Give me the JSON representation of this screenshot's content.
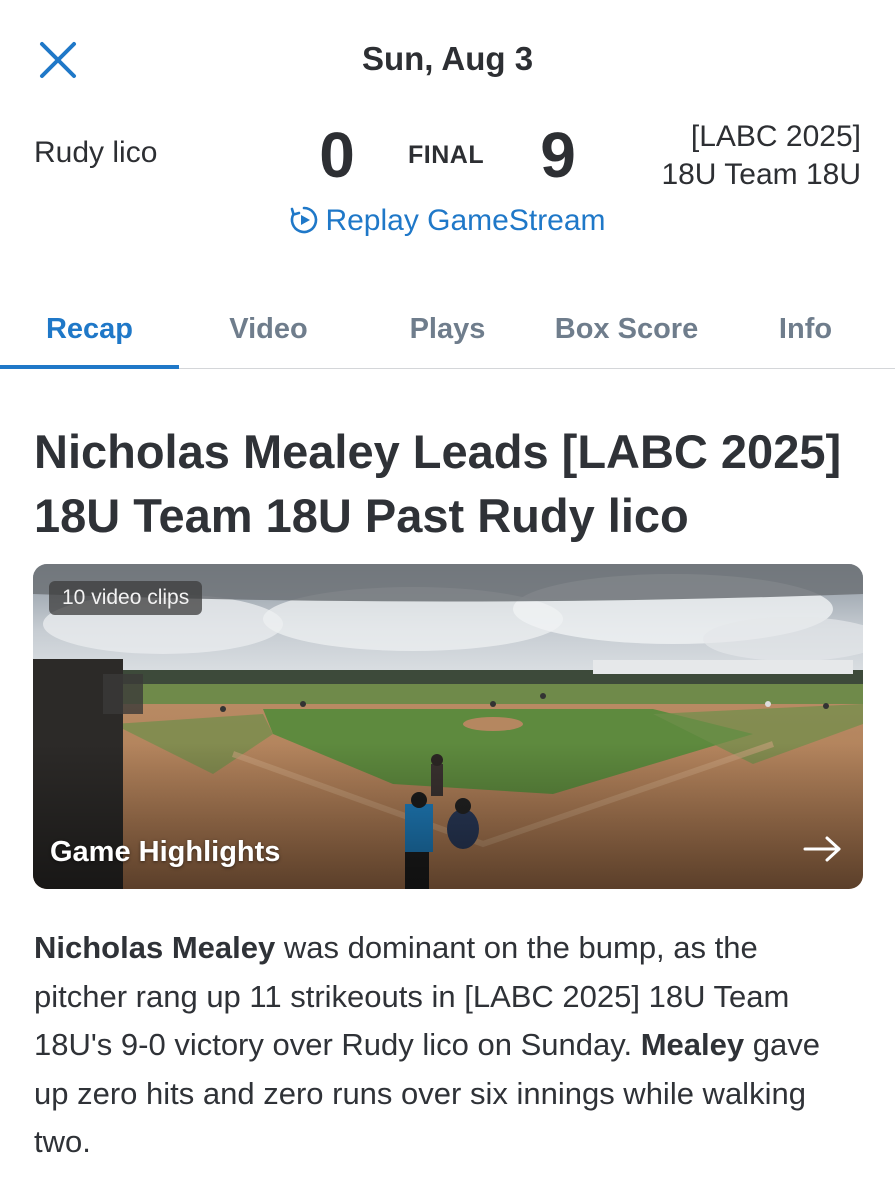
{
  "header": {
    "date": "Sun, Aug 3",
    "close_icon": "close-icon"
  },
  "scoreboard": {
    "away_team": "Rudy lico",
    "away_score": "0",
    "status": "FINAL",
    "home_score": "9",
    "home_team_line1": "[LABC 2025]",
    "home_team_line2": "18U Team 18U"
  },
  "replay": {
    "label": "Replay GameStream",
    "icon": "replay-play-icon"
  },
  "tabs": [
    {
      "label": "Recap",
      "active": true
    },
    {
      "label": "Video",
      "active": false
    },
    {
      "label": "Plays",
      "active": false
    },
    {
      "label": "Box Score",
      "active": false
    },
    {
      "label": "Info",
      "active": false
    }
  ],
  "article": {
    "headline": "Nicholas Mealey Leads [LABC 2025] 18U Team 18U Past Rudy lico",
    "video": {
      "badge": "10 video clips",
      "title": "Game Highlights",
      "arrow_icon": "arrow-right-icon"
    },
    "body": {
      "p1_bold": "Nicholas Mealey",
      "p1_text": " was dominant on the bump, as the pitcher rang up 11 strikeouts in [LABC 2025] 18U Team 18U's 9-0 victory over Rudy lico on Sunday. ",
      "p2_bold": "Mealey",
      "p2_text": " gave up zero hits and zero runs over six innings while walking two."
    }
  },
  "colors": {
    "accent": "#1f78c8",
    "text": "#2f3237",
    "tab_inactive": "#6f7d8c"
  }
}
